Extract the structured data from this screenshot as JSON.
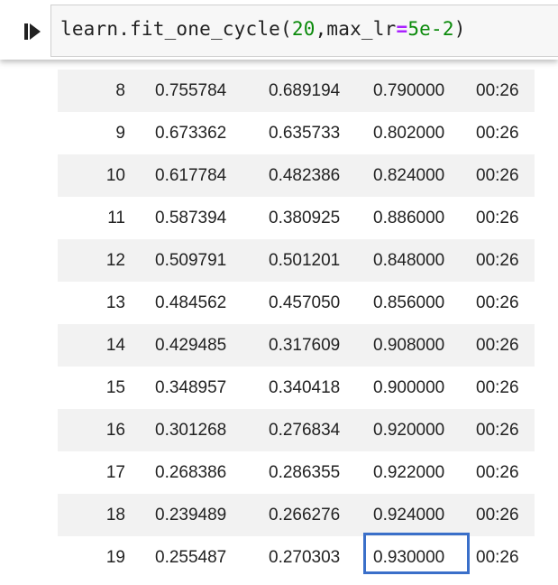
{
  "cell": {
    "code_fn": "learn.fit_one_cycle(",
    "code_arg1": "20",
    "code_sep": ",max_lr",
    "code_eq": "=",
    "code_arg2": "5e-2",
    "code_close": ")"
  },
  "rows": [
    {
      "epoch": "8",
      "train_loss": "0.755784",
      "valid_loss": "0.689194",
      "accuracy": "0.790000",
      "time": "00:26"
    },
    {
      "epoch": "9",
      "train_loss": "0.673362",
      "valid_loss": "0.635733",
      "accuracy": "0.802000",
      "time": "00:26"
    },
    {
      "epoch": "10",
      "train_loss": "0.617784",
      "valid_loss": "0.482386",
      "accuracy": "0.824000",
      "time": "00:26"
    },
    {
      "epoch": "11",
      "train_loss": "0.587394",
      "valid_loss": "0.380925",
      "accuracy": "0.886000",
      "time": "00:26"
    },
    {
      "epoch": "12",
      "train_loss": "0.509791",
      "valid_loss": "0.501201",
      "accuracy": "0.848000",
      "time": "00:26"
    },
    {
      "epoch": "13",
      "train_loss": "0.484562",
      "valid_loss": "0.457050",
      "accuracy": "0.856000",
      "time": "00:26"
    },
    {
      "epoch": "14",
      "train_loss": "0.429485",
      "valid_loss": "0.317609",
      "accuracy": "0.908000",
      "time": "00:26"
    },
    {
      "epoch": "15",
      "train_loss": "0.348957",
      "valid_loss": "0.340418",
      "accuracy": "0.900000",
      "time": "00:26"
    },
    {
      "epoch": "16",
      "train_loss": "0.301268",
      "valid_loss": "0.276834",
      "accuracy": "0.920000",
      "time": "00:26"
    },
    {
      "epoch": "17",
      "train_loss": "0.268386",
      "valid_loss": "0.286355",
      "accuracy": "0.922000",
      "time": "00:26"
    },
    {
      "epoch": "18",
      "train_loss": "0.239489",
      "valid_loss": "0.266276",
      "accuracy": "0.924000",
      "time": "00:26"
    },
    {
      "epoch": "19",
      "train_loss": "0.255487",
      "valid_loss": "0.270303",
      "accuracy": "0.930000",
      "time": "00:26"
    }
  ],
  "colors": {
    "highlight_border": "#3a6fc9",
    "shaded_row": "#f2f2f2",
    "number_literal": "#0b8a0b",
    "operator": "#aa22ff"
  },
  "icons": {
    "run": "run-cell-icon"
  }
}
